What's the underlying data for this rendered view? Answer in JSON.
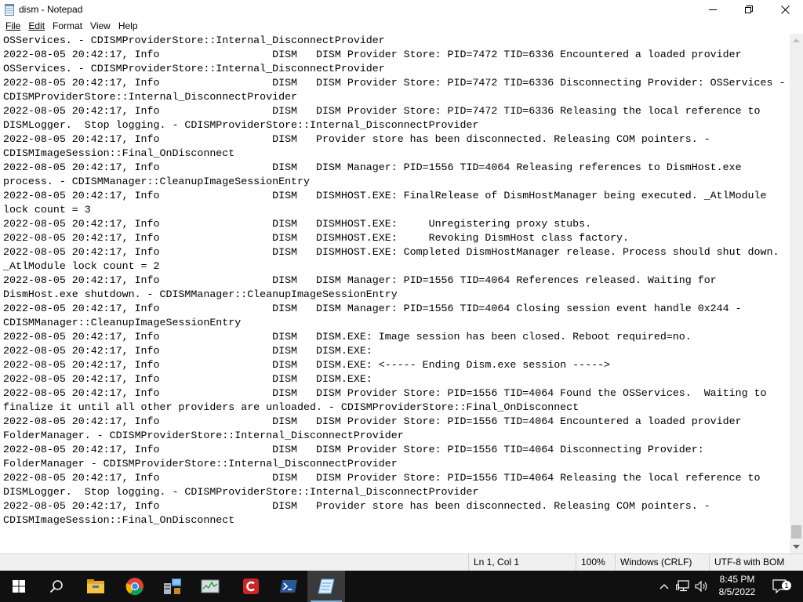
{
  "window": {
    "title": "dism - Notepad"
  },
  "menu": {
    "items": [
      {
        "label": "File"
      },
      {
        "label": "Edit"
      },
      {
        "label": "Format"
      },
      {
        "label": "View"
      },
      {
        "label": "Help"
      }
    ]
  },
  "editor": {
    "text": "OSServices. - CDISMProviderStore::Internal_DisconnectProvider\n2022-08-05 20:42:17, Info                  DISM   DISM Provider Store: PID=7472 TID=6336 Encountered a loaded provider\nOSServices. - CDISMProviderStore::Internal_DisconnectProvider\n2022-08-05 20:42:17, Info                  DISM   DISM Provider Store: PID=7472 TID=6336 Disconnecting Provider: OSServices -\nCDISMProviderStore::Internal_DisconnectProvider\n2022-08-05 20:42:17, Info                  DISM   DISM Provider Store: PID=7472 TID=6336 Releasing the local reference to\nDISMLogger.  Stop logging. - CDISMProviderStore::Internal_DisconnectProvider\n2022-08-05 20:42:17, Info                  DISM   Provider store has been disconnected. Releasing COM pointers. -\nCDISMImageSession::Final_OnDisconnect\n2022-08-05 20:42:17, Info                  DISM   DISM Manager: PID=1556 TID=4064 Releasing references to DismHost.exe\nprocess. - CDISMManager::CleanupImageSessionEntry\n2022-08-05 20:42:17, Info                  DISM   DISMHOST.EXE: FinalRelease of DismHostManager being executed. _AtlModule\nlock count = 3\n2022-08-05 20:42:17, Info                  DISM   DISMHOST.EXE:     Unregistering proxy stubs.\n2022-08-05 20:42:17, Info                  DISM   DISMHOST.EXE:     Revoking DismHost class factory.\n2022-08-05 20:42:17, Info                  DISM   DISMHOST.EXE: Completed DismHostManager release. Process should shut down.\n_AtlModule lock count = 2\n2022-08-05 20:42:17, Info                  DISM   DISM Manager: PID=1556 TID=4064 References released. Waiting for\nDismHost.exe shutdown. - CDISMManager::CleanupImageSessionEntry\n2022-08-05 20:42:17, Info                  DISM   DISM Manager: PID=1556 TID=4064 Closing session event handle 0x244 -\nCDISMManager::CleanupImageSessionEntry\n2022-08-05 20:42:17, Info                  DISM   DISM.EXE: Image session has been closed. Reboot required=no.\n2022-08-05 20:42:17, Info                  DISM   DISM.EXE:\n2022-08-05 20:42:17, Info                  DISM   DISM.EXE: <----- Ending Dism.exe session ----->\n2022-08-05 20:42:17, Info                  DISM   DISM.EXE:\n2022-08-05 20:42:17, Info                  DISM   DISM Provider Store: PID=1556 TID=4064 Found the OSServices.  Waiting to\nfinalize it until all other providers are unloaded. - CDISMProviderStore::Final_OnDisconnect\n2022-08-05 20:42:17, Info                  DISM   DISM Provider Store: PID=1556 TID=4064 Encountered a loaded provider\nFolderManager. - CDISMProviderStore::Internal_DisconnectProvider\n2022-08-05 20:42:17, Info                  DISM   DISM Provider Store: PID=1556 TID=4064 Disconnecting Provider:\nFolderManager - CDISMProviderStore::Internal_DisconnectProvider\n2022-08-05 20:42:17, Info                  DISM   DISM Provider Store: PID=1556 TID=4064 Releasing the local reference to\nDISMLogger.  Stop logging. - CDISMProviderStore::Internal_DisconnectProvider\n2022-08-05 20:42:17, Info                  DISM   Provider store has been disconnected. Releasing COM pointers. -\nCDISMImageSession::Final_OnDisconnect"
  },
  "statusbar": {
    "position": "Ln 1, Col 1",
    "zoom": "100%",
    "line_ending": "Windows (CRLF)",
    "encoding": "UTF-8 with BOM"
  },
  "taskbar": {
    "apps": [
      {
        "icon": "windows-start-icon"
      },
      {
        "icon": "search-icon"
      },
      {
        "icon": "file-explorer-icon"
      },
      {
        "icon": "chrome-icon"
      },
      {
        "icon": "server-manager-icon"
      },
      {
        "icon": "task-manager-icon"
      },
      {
        "icon": "red-c-app-icon"
      },
      {
        "icon": "powershell-icon"
      },
      {
        "icon": "notepad-icon"
      }
    ],
    "clock": {
      "time": "8:45 PM",
      "date": "8/5/2022"
    },
    "notification_count": "1"
  }
}
